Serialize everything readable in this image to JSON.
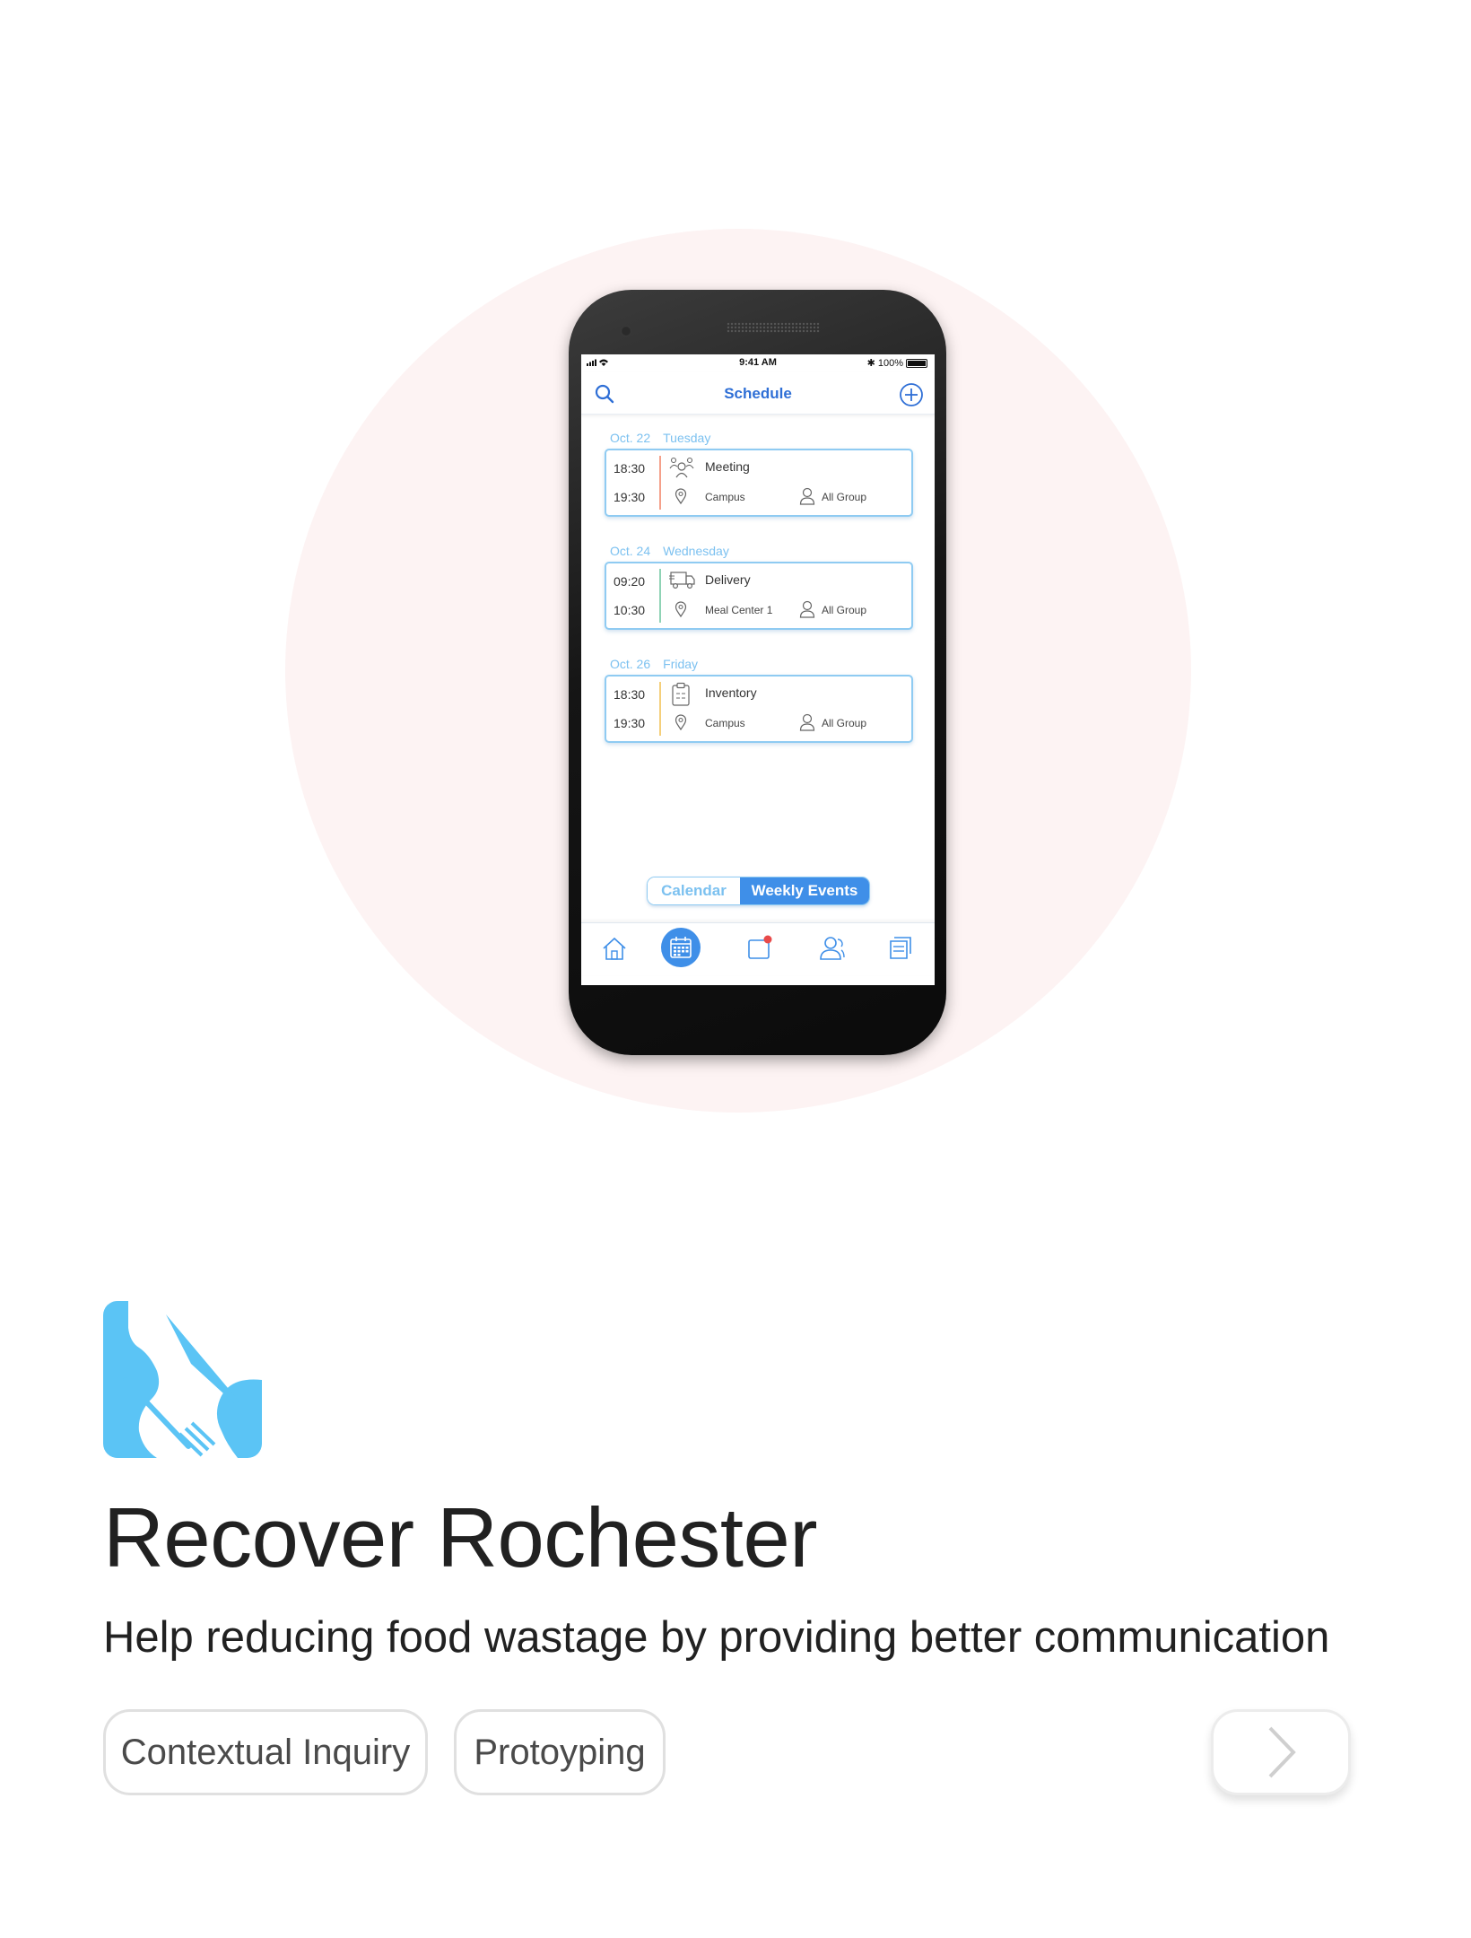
{
  "phone": {
    "status": {
      "time": "9:41 AM",
      "battery": "100%"
    },
    "header": {
      "title": "Schedule"
    },
    "days": [
      {
        "date": "Oct. 22",
        "weekday": "Tuesday",
        "event": {
          "start": "18:30",
          "end": "19:30",
          "name": "Meeting",
          "location": "Campus",
          "group": "All Group",
          "accent": "#f5a08a",
          "icon": "people-icon"
        }
      },
      {
        "date": "Oct. 24",
        "weekday": "Wednesday",
        "event": {
          "start": "09:20",
          "end": "10:30",
          "name": "Delivery",
          "location": "Meal Center 1",
          "group": "All Group",
          "accent": "#8fd3b5",
          "icon": "truck-icon"
        }
      },
      {
        "date": "Oct. 26",
        "weekday": "Friday",
        "event": {
          "start": "18:30",
          "end": "19:30",
          "name": "Inventory",
          "location": "Campus",
          "group": "All Group",
          "accent": "#f5cf7a",
          "icon": "clipboard-icon"
        }
      }
    ],
    "toggle": {
      "calendar": "Calendar",
      "weekly": "Weekly Events",
      "selected": "Weekly Events"
    },
    "tabs": [
      "home-icon",
      "calendar-icon",
      "notification-icon",
      "people-icon",
      "documents-icon"
    ]
  },
  "project": {
    "title": "Recover Rochester",
    "subtitle": "Help reducing food wastage by providing better communication",
    "tags": [
      "Contextual Inquiry",
      "Protoyping"
    ]
  },
  "colors": {
    "accent": "#3f8fe8",
    "logo": "#5bc4f5",
    "bg_circle": "#fdf3f3"
  }
}
